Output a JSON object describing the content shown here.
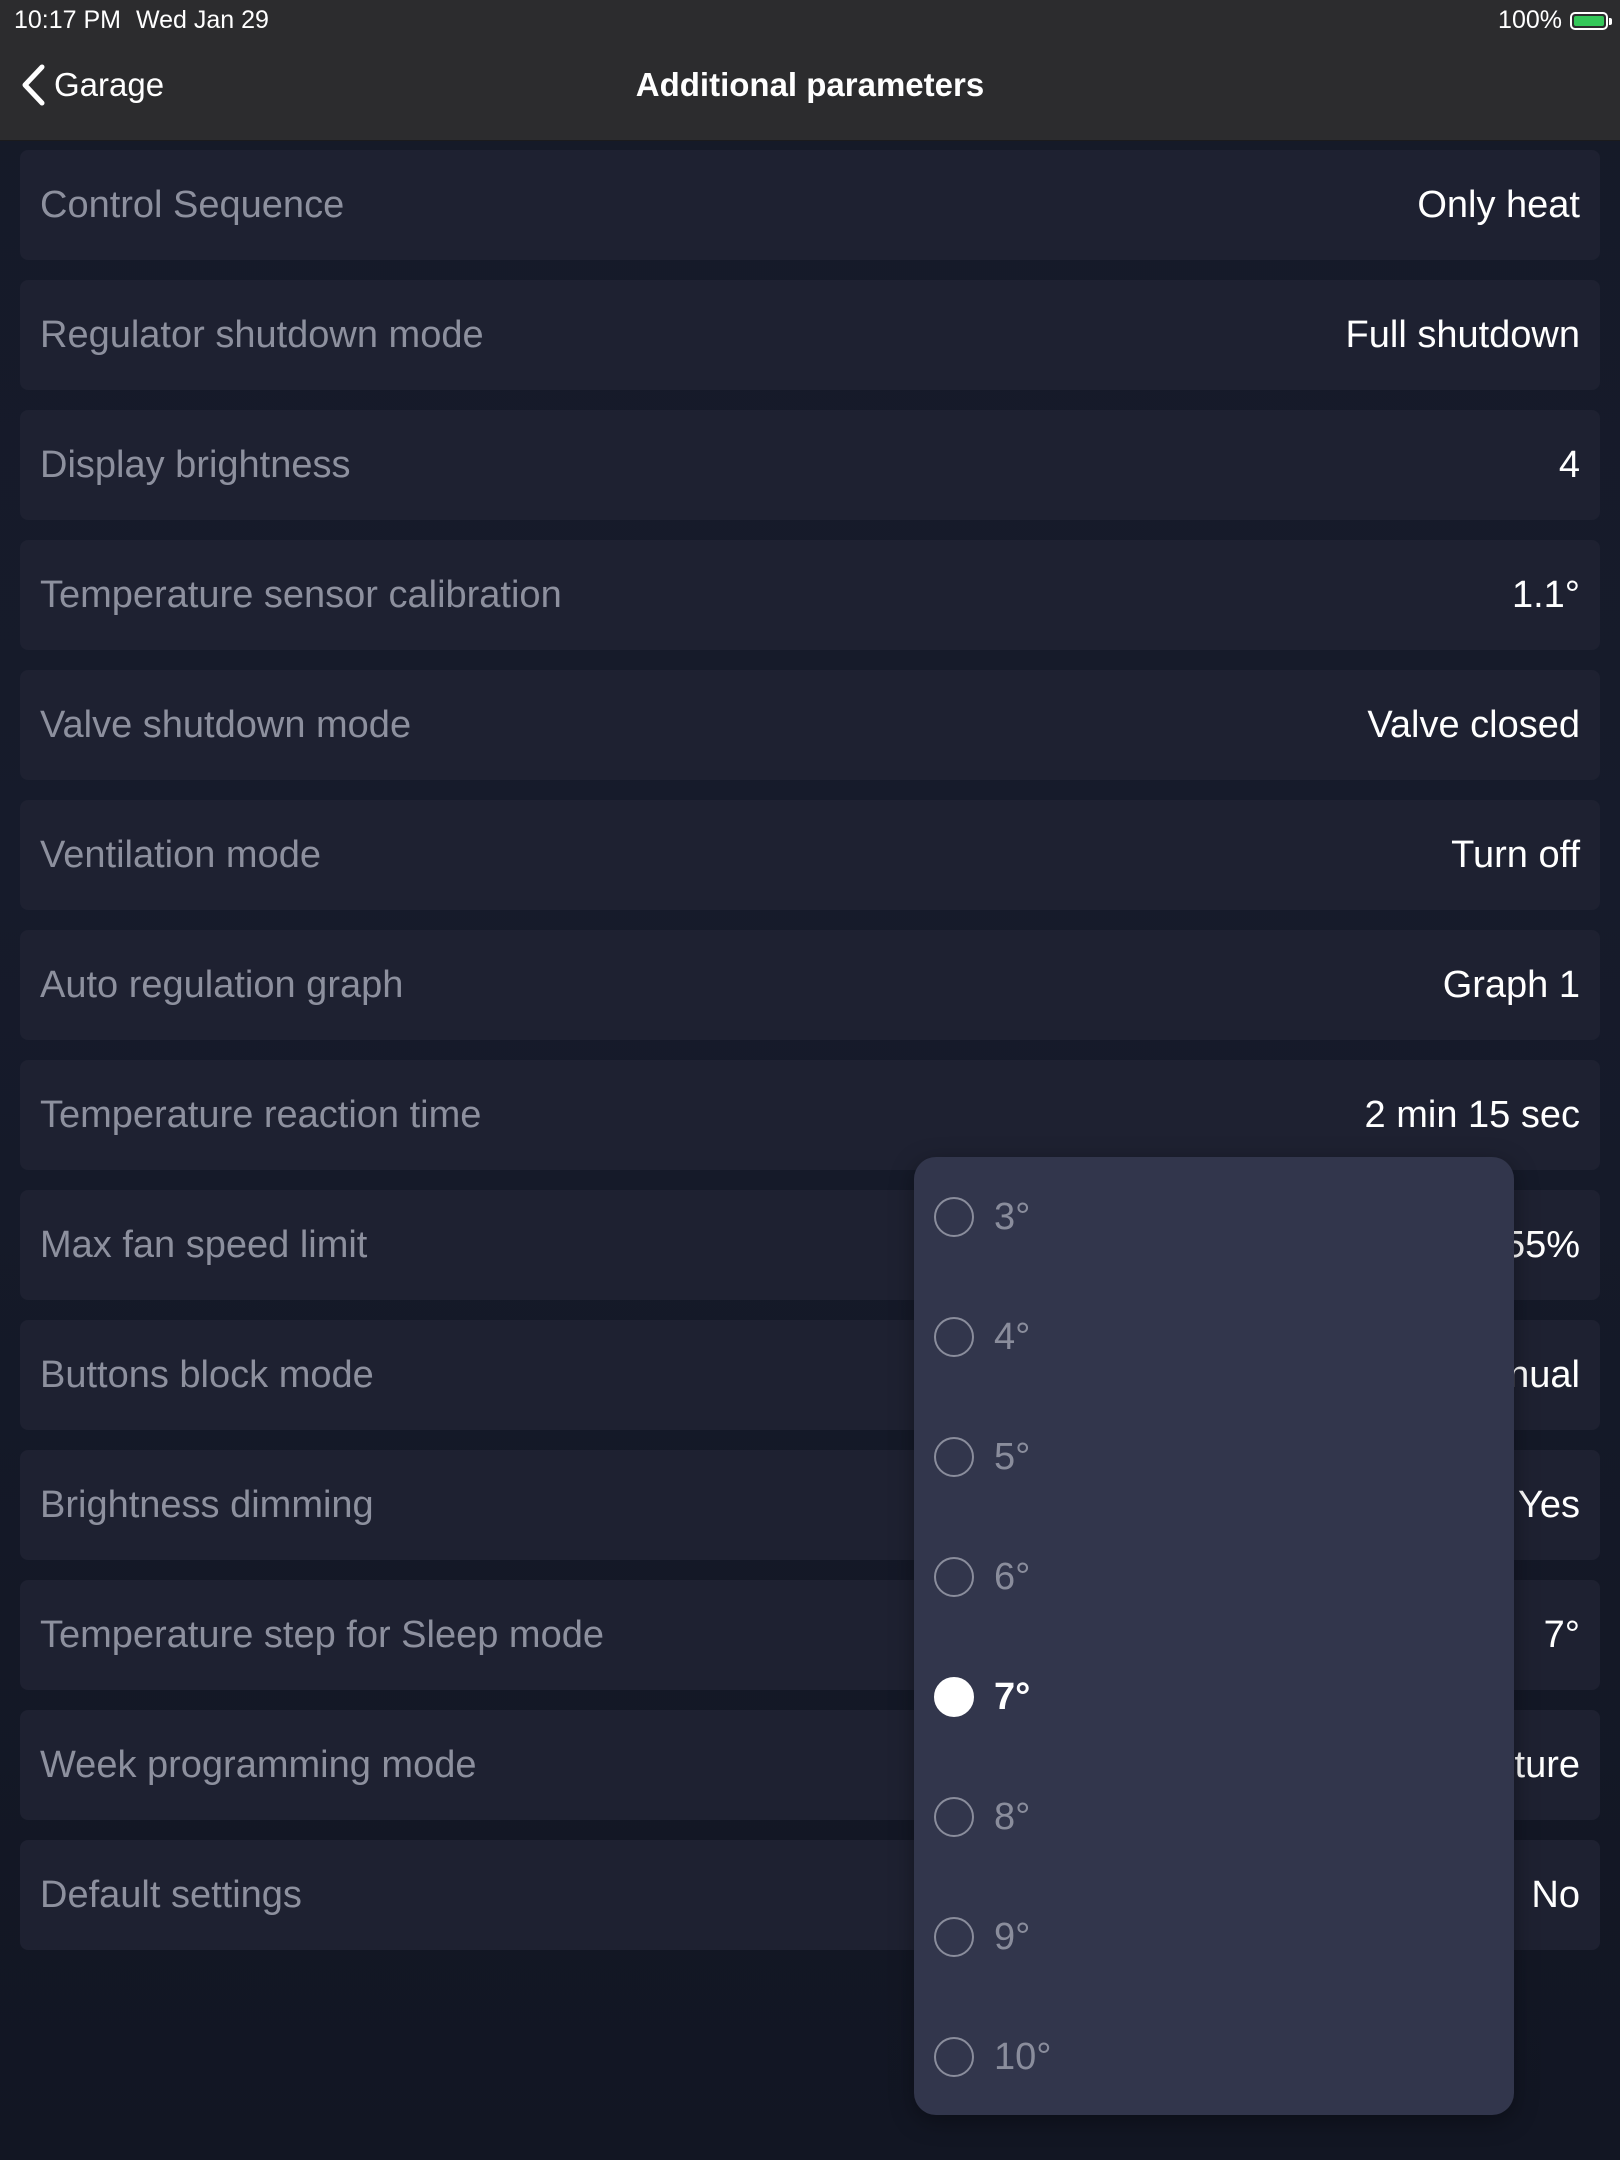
{
  "status_bar": {
    "time": "10:17 PM",
    "date": "Wed Jan 29",
    "battery": "100%",
    "battery_color": "#34c759"
  },
  "nav": {
    "back_label": "Garage",
    "back_icon": "chevron-left-icon",
    "title": "Additional parameters"
  },
  "rows": [
    {
      "label": "Control Sequence",
      "value": "Only heat"
    },
    {
      "label": "Regulator shutdown mode",
      "value": "Full shutdown"
    },
    {
      "label": "Display brightness",
      "value": "4"
    },
    {
      "label": "Temperature sensor calibration",
      "value": "1.1°"
    },
    {
      "label": "Valve shutdown mode",
      "value": "Valve closed"
    },
    {
      "label": "Ventilation mode",
      "value": "Turn off"
    },
    {
      "label": "Auto regulation graph",
      "value": "Graph 1"
    },
    {
      "label": "Temperature reaction time",
      "value": "2 min 15 sec"
    },
    {
      "label": "Max fan speed limit",
      "value": "55%"
    },
    {
      "label": "Buttons block mode",
      "value": "nual"
    },
    {
      "label": "Brightness dimming",
      "value": "Yes"
    },
    {
      "label": "Temperature step for Sleep mode",
      "value": "7°"
    },
    {
      "label": "Week programming mode",
      "value": "ture"
    },
    {
      "label": "Default settings",
      "value": "No"
    }
  ],
  "picker": {
    "selected_index": 4,
    "options": [
      {
        "label": "3°"
      },
      {
        "label": "4°"
      },
      {
        "label": "5°"
      },
      {
        "label": "6°"
      },
      {
        "label": "7°"
      },
      {
        "label": "8°"
      },
      {
        "label": "9°"
      },
      {
        "label": "10°"
      }
    ]
  },
  "colors": {
    "background": "#151a28",
    "row_background": "#1e2131",
    "label_text": "#8d909e",
    "picker_background": "#32364c"
  }
}
